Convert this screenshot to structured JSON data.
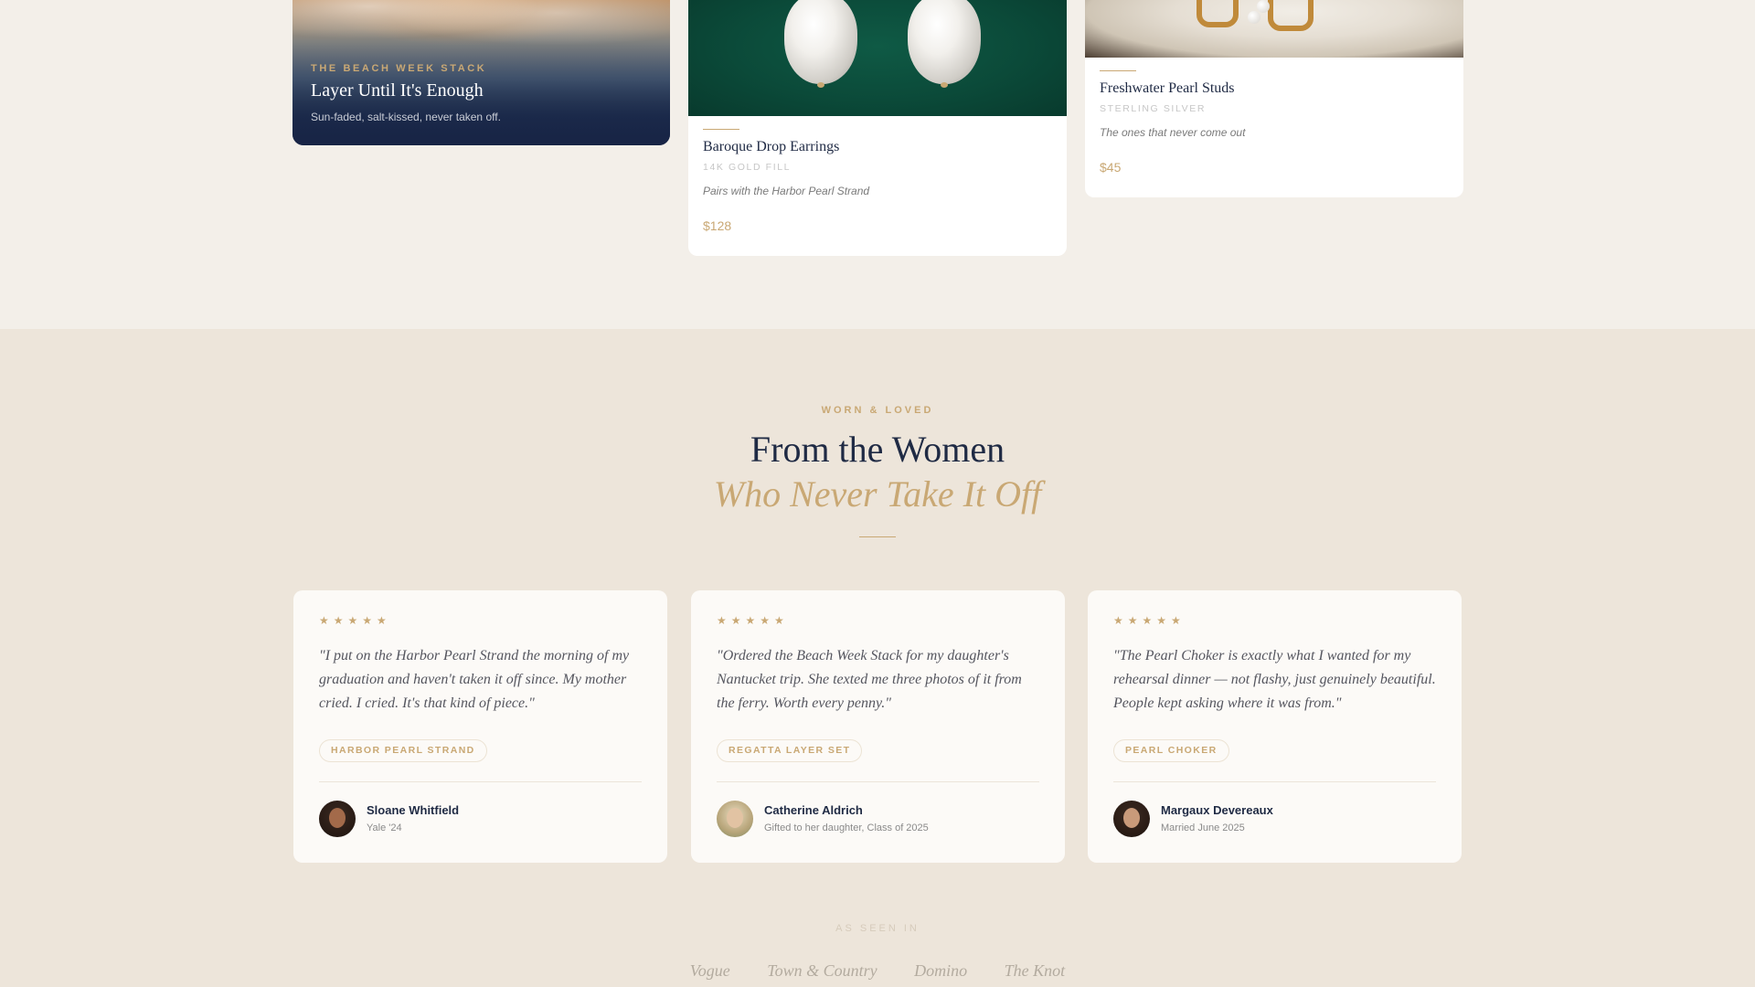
{
  "colors": {
    "page_bg": "#f3efe9",
    "section_bg": "#ede5da",
    "navy": "#1f2a44",
    "gold": "#c9a874",
    "card_bg": "#ffffff"
  },
  "hero_card": {
    "eyebrow": "THE BEACH WEEK STACK",
    "title": "Layer Until It's Enough",
    "subtitle": "Sun-faded, salt-kissed, never taken off."
  },
  "products": [
    {
      "name": "Baroque Drop Earrings",
      "metal": "14K GOLD FILL",
      "note": "Pairs with the Harbor Pearl Strand",
      "price": "$128"
    },
    {
      "name": "Freshwater Pearl Studs",
      "metal": "STERLING SILVER",
      "note": "The ones that never come out",
      "price": "$45"
    }
  ],
  "testimonials_section": {
    "eyebrow": "WORN & LOVED",
    "heading_line1": "From the Women",
    "heading_line2": "Who Never Take It Off",
    "items": [
      {
        "rating": 5,
        "stars": "★★★★★",
        "quote": "\"I put on the Harbor Pearl Strand the morning of my graduation and haven't taken it off since. My mother cried. I cried. It's that kind of piece.\"",
        "product_tag": "HARBOR PEARL STRAND",
        "author": "Sloane Whitfield",
        "detail": "Yale '24"
      },
      {
        "rating": 5,
        "stars": "★★★★★",
        "quote": "\"Ordered the Beach Week Stack for my daughter's Nantucket trip. She texted me three photos of it from the ferry. Worth every penny.\"",
        "product_tag": "REGATTA LAYER SET",
        "author": "Catherine Aldrich",
        "detail": "Gifted to her daughter, Class of 2025"
      },
      {
        "rating": 5,
        "stars": "★★★★★",
        "quote": "\"The Pearl Choker is exactly what I wanted for my rehearsal dinner — not flashy, just genuinely beautiful. People kept asking where it was from.\"",
        "product_tag": "PEARL CHOKER",
        "author": "Margaux Devereaux",
        "detail": "Married June 2025"
      }
    ]
  },
  "press": {
    "label": "AS SEEN IN",
    "outlets": [
      "Vogue",
      "Town & Country",
      "Domino",
      "The Knot"
    ]
  }
}
